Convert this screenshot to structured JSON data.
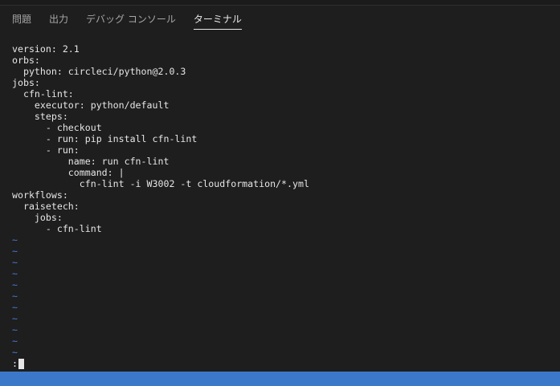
{
  "tabs": [
    {
      "label": "問題",
      "active": false
    },
    {
      "label": "出力",
      "active": false
    },
    {
      "label": "デバッグ コンソール",
      "active": false
    },
    {
      "label": "ターミナル",
      "active": true
    }
  ],
  "terminal": {
    "lines": [
      "version: 2.1",
      "orbs:",
      "  python: circleci/python@2.0.3",
      "jobs:",
      "  cfn-lint:",
      "    executor: python/default",
      "    steps:",
      "      - checkout",
      "      - run: pip install cfn-lint",
      "      - run:",
      "          name: run cfn-lint",
      "          command: |",
      "            cfn-lint -i W3002 -t cloudformation/*.yml",
      "workflows:",
      "  raisetech:",
      "    jobs:",
      "      - cfn-lint"
    ],
    "tilde_lines": [
      "~",
      "~",
      "~",
      "~",
      "~",
      "~",
      "~",
      "~",
      "~",
      "~",
      "~"
    ],
    "command_prompt": ":"
  },
  "colors": {
    "background": "#1e1e1e",
    "text": "#e6e6e6",
    "tilde": "#4a78d8",
    "status_bar": "#3c78c9"
  }
}
